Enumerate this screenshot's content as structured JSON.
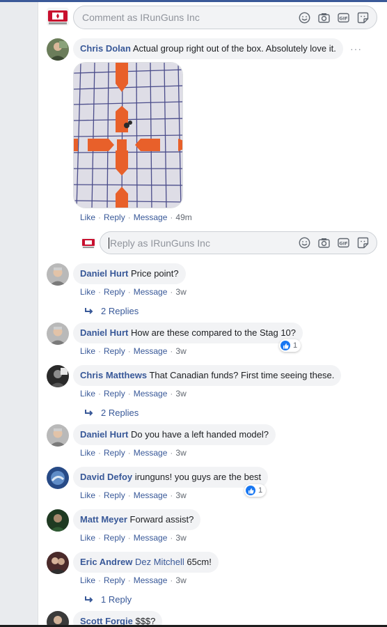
{
  "top_composer": {
    "placeholder": "Comment as IRunGuns Inc",
    "icons": [
      "emoji-icon",
      "camera-icon",
      "gif-icon",
      "sticker-icon"
    ]
  },
  "reply_composer": {
    "placeholder": "Reply as IRunGuns Inc"
  },
  "action_labels": {
    "like": "Like",
    "reply": "Reply",
    "message": "Message"
  },
  "comments": [
    {
      "author": "Chris Dolan",
      "text": "Actual group right out of the box. Absolutely love it.",
      "time": "49m",
      "has_photo": true
    },
    {
      "author": "Daniel Hurt",
      "text": "Price point?",
      "time": "3w",
      "replies": "2 Replies"
    },
    {
      "author": "Daniel Hurt",
      "text": "How are these compared to the Stag 10?",
      "time": "3w",
      "reactions": "1"
    },
    {
      "author": "Chris Matthews",
      "text": "That Canadian funds? First time seeing these.",
      "time": "3w",
      "replies": "2 Replies"
    },
    {
      "author": "Daniel Hurt",
      "text": "Do you have a left handed model?",
      "time": "3w"
    },
    {
      "author": "David Defoy",
      "text": "irunguns! you guys are the best",
      "time": "3w",
      "reactions": "1"
    },
    {
      "author": "Matt Meyer",
      "text": "Forward assist?",
      "time": "3w"
    },
    {
      "author": "Eric Andrew",
      "mention": "Dez Mitchell",
      "text": "65cm!",
      "time": "3w",
      "replies": "1 Reply"
    },
    {
      "author": "Scott Forgie",
      "text": "$$$?"
    }
  ],
  "colors": {
    "link": "#385898",
    "bubble": "#f2f3f5",
    "like_blue": "#1877f2",
    "gutter": "#e9ebee"
  }
}
